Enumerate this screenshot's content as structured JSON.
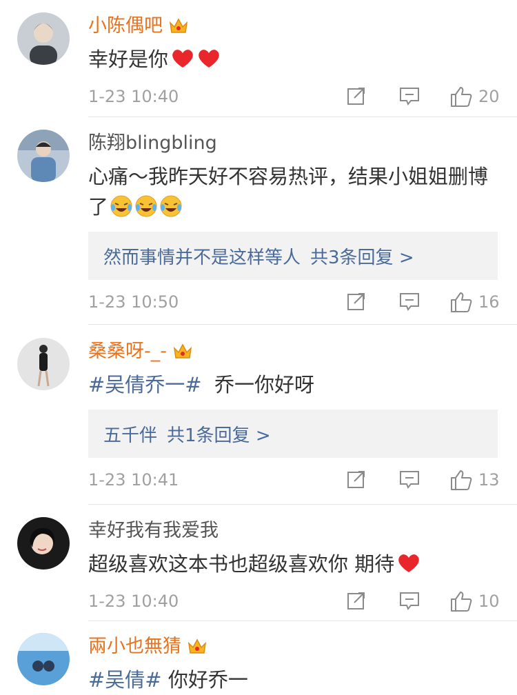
{
  "comments": [
    {
      "username": "小陈偶吧",
      "vip": true,
      "text_parts": [
        "幸好是你"
      ],
      "hearts": 2,
      "emojis": 0,
      "replies": null,
      "time": "1-23 10:40",
      "likes": "20"
    },
    {
      "username": "陈翔blingbling",
      "vip": false,
      "text_parts": [
        "心痛～我昨天好不容易热评，结果小姐姐删博了"
      ],
      "hearts": 0,
      "emojis": 3,
      "replies": {
        "names": "然而事情并不是这样等人",
        "count": "共3条回复 >"
      },
      "time": "1-23 10:50",
      "likes": "16"
    },
    {
      "username": "桑桑呀-_-",
      "vip": true,
      "tag": "#吴倩乔一#",
      "text_parts": [
        "乔一你好呀"
      ],
      "hearts": 0,
      "emojis": 0,
      "replies": {
        "names": "五千伴",
        "count": "共1条回复 >"
      },
      "time": "1-23 10:41",
      "likes": "13"
    },
    {
      "username": "幸好我有我爱我",
      "vip": false,
      "text_parts": [
        "超级喜欢这本书也超级喜欢你  期待"
      ],
      "hearts": 1,
      "emojis": 0,
      "replies": null,
      "time": "1-23 10:40",
      "likes": "10"
    },
    {
      "username": "兩小也無猜",
      "vip": true,
      "tag": "#吴倩#",
      "text_parts": [
        "你好乔一"
      ],
      "hearts": 0,
      "emojis": 0,
      "replies": null,
      "time": "",
      "likes": ""
    }
  ],
  "icons": {
    "share": "share-icon",
    "comment": "comment-icon",
    "like": "thumb-up-icon",
    "crown": "vip-crown-icon",
    "heart": "heart-emoji",
    "laugh": "laugh-cry-emoji"
  },
  "colors": {
    "vip_name": "#e8731f",
    "link": "#4a6a9a",
    "meta": "#a0a0a0",
    "heart": "#e8262c"
  }
}
